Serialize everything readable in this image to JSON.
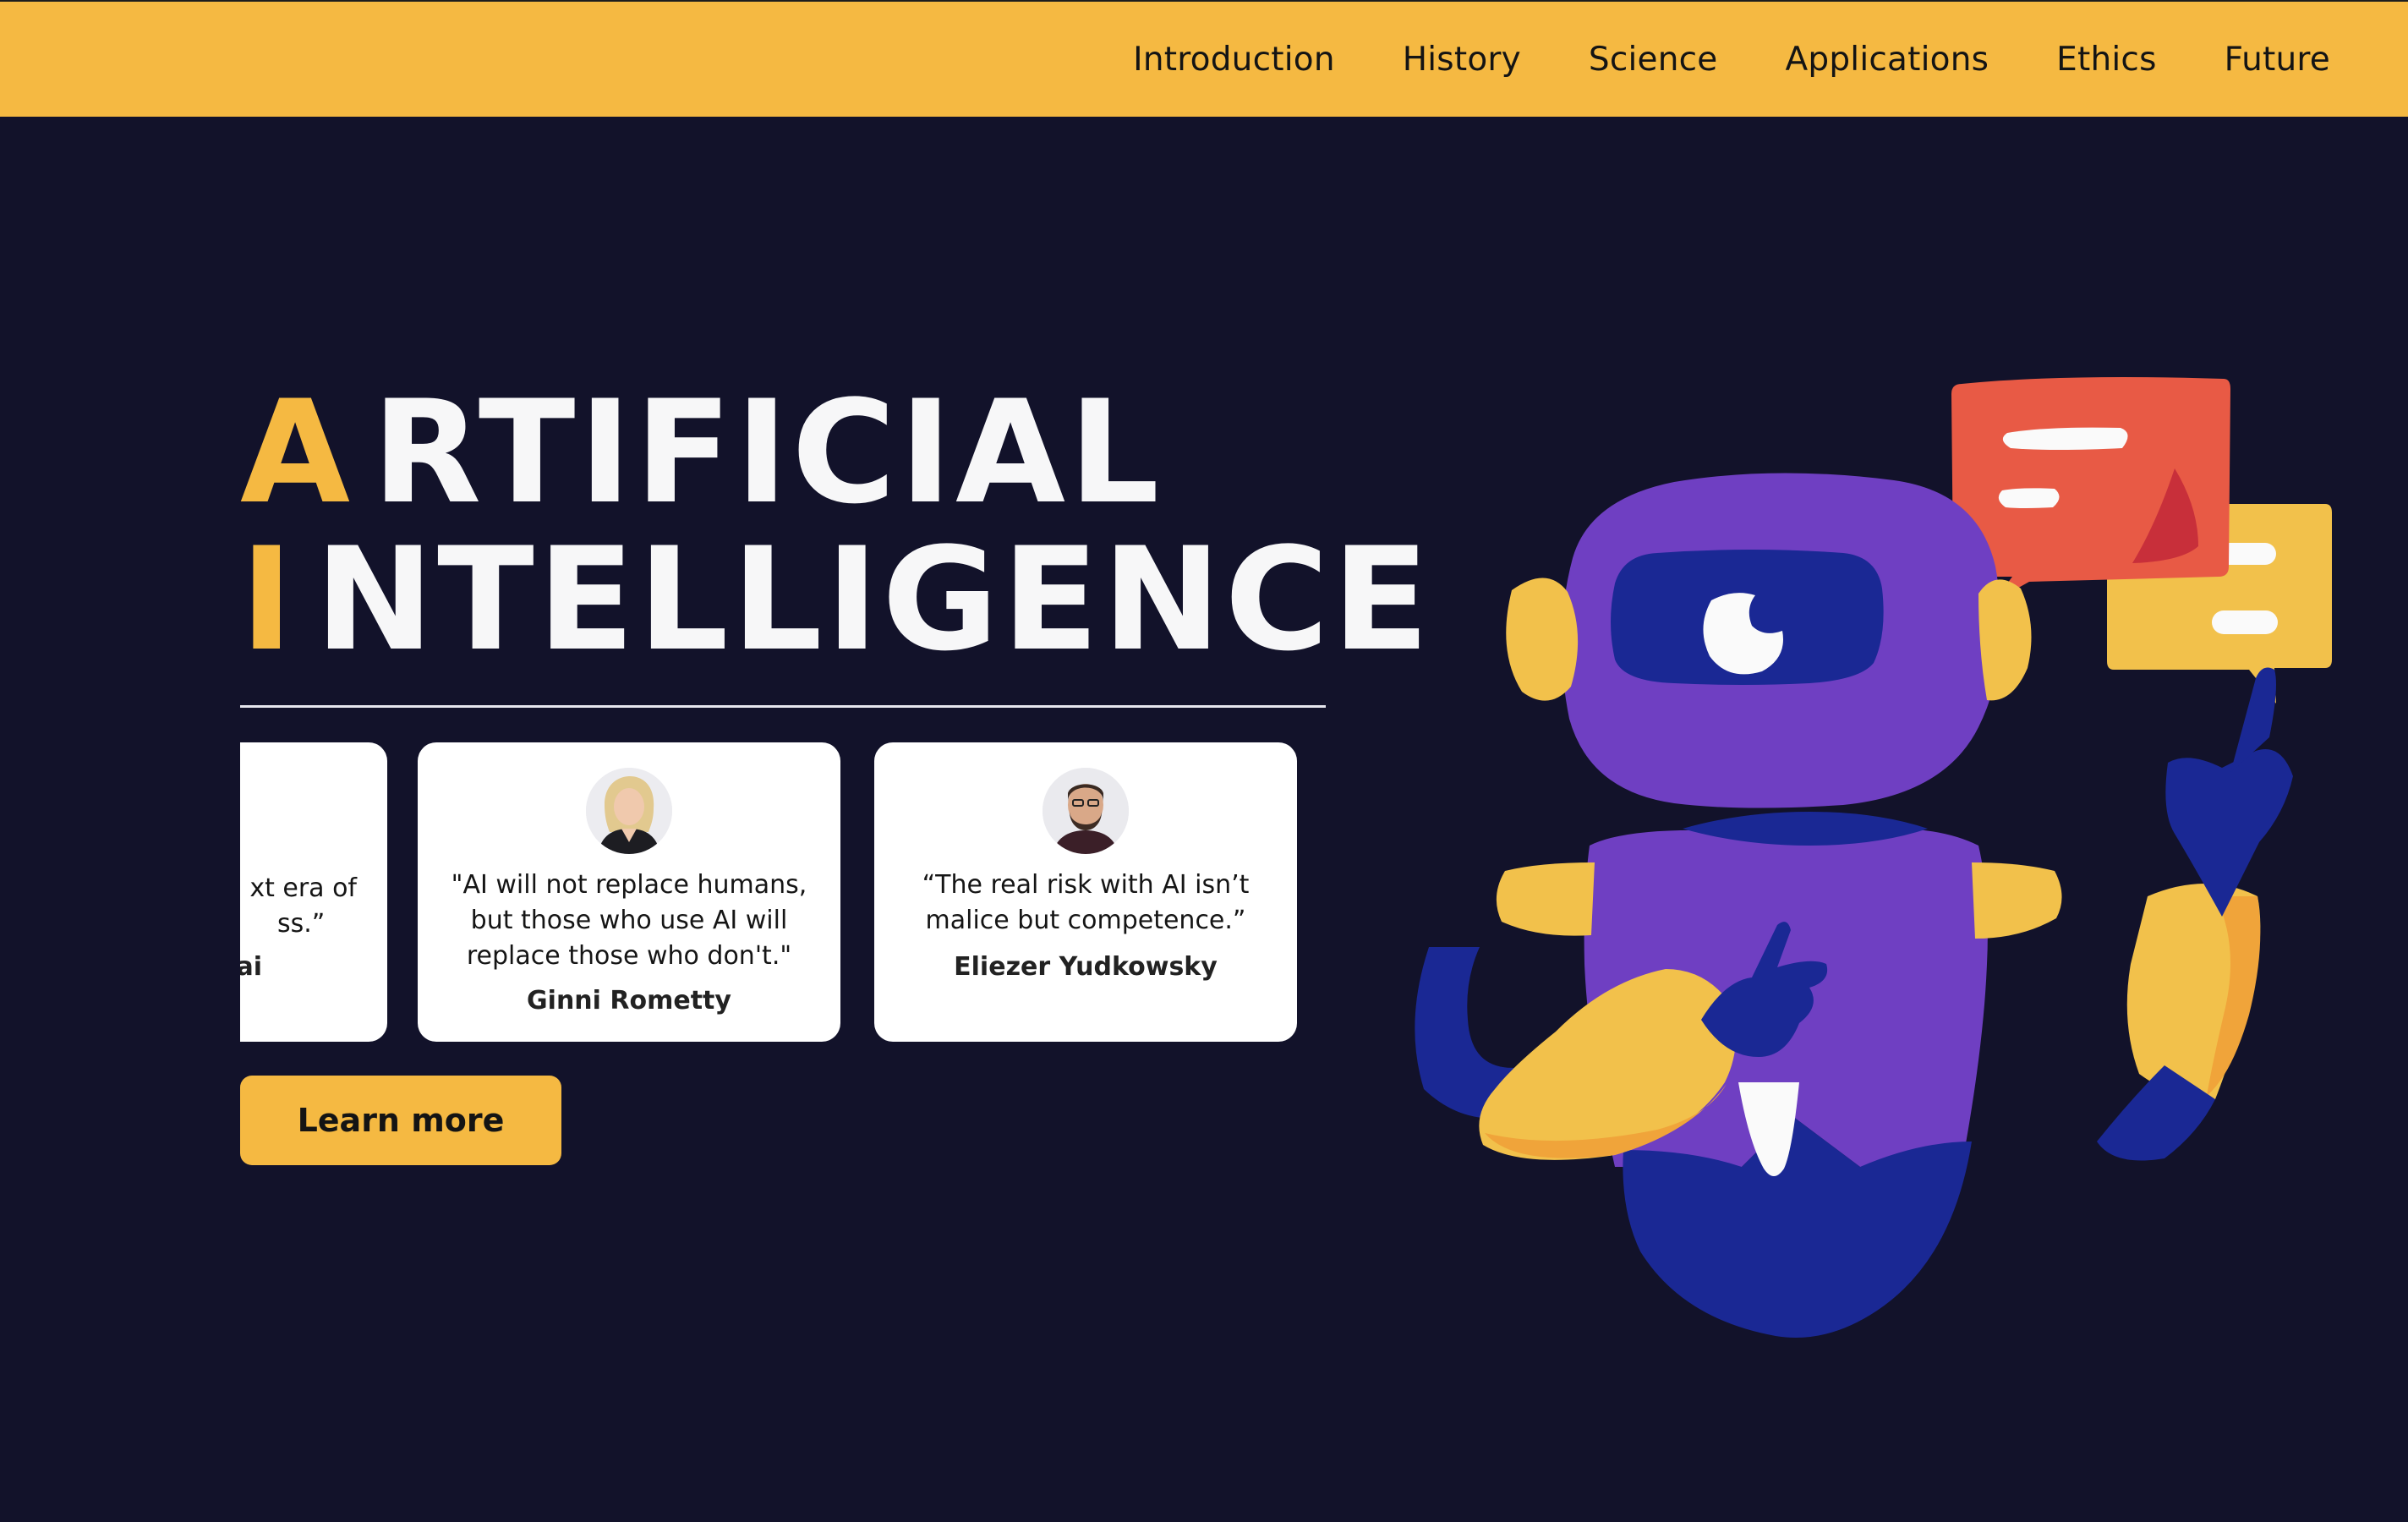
{
  "nav": {
    "items": [
      "Introduction",
      "History",
      "Science",
      "Applications",
      "Ethics",
      "Future"
    ]
  },
  "hero": {
    "title_line1_initial": "A",
    "title_line1_rest": "RTIFICIAL",
    "title_line2_initial": "I",
    "title_line2_rest": "NTELLIGENCE"
  },
  "quotes": [
    {
      "text_line1": "xt era of",
      "text_line2": "ss.”",
      "author": "ai"
    },
    {
      "text": "\"AI will not replace humans, but those who use AI will replace those who don't.\"",
      "author": "Ginni Rometty"
    },
    {
      "text": "“The real risk with AI isn’t malice but competence.”",
      "author": "Eliezer Yudkowsky"
    }
  ],
  "cta": {
    "learn_more": "Learn more"
  },
  "colors": {
    "accent": "#f5b942",
    "background": "#12122a",
    "robot_purple": "#6f3fc2",
    "robot_blue": "#1a2894",
    "speech_red": "#e85a45"
  },
  "icons": {
    "illustration": "robot-illustration",
    "speech": "speech-bubble-icon"
  }
}
